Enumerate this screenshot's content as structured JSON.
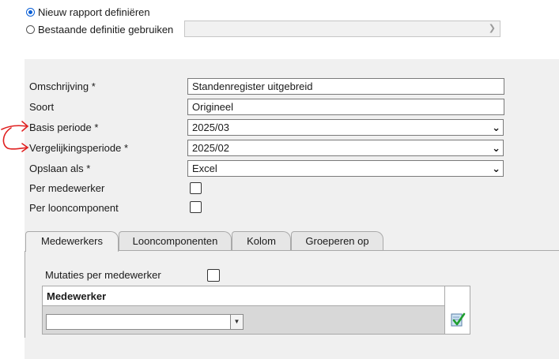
{
  "report_choice": {
    "new_label": "Nieuw rapport definiëren",
    "existing_label": "Bestaande definitie gebruiken",
    "existing_value": ""
  },
  "form": {
    "omschrijving_label": "Omschrijving *",
    "omschrijving_value": "Standenregister uitgebreid",
    "soort_label": "Soort",
    "soort_value": "Origineel",
    "basis_label": "Basis periode *",
    "basis_value": "2025/03",
    "vergelijk_label": "Vergelijkingsperiode *",
    "vergelijk_value": "2025/02",
    "opslaan_label": "Opslaan als *",
    "opslaan_value": "Excel",
    "per_medewerker_label": "Per medewerker",
    "per_looncomponent_label": "Per looncomponent"
  },
  "tabs": [
    {
      "label": "Medewerkers"
    },
    {
      "label": "Looncomponenten"
    },
    {
      "label": "Kolom"
    },
    {
      "label": "Groeperen op"
    }
  ],
  "medewerkers_tab": {
    "mutaties_label": "Mutaties per medewerker",
    "grid_header": "Medewerker",
    "combo_value": ""
  },
  "icons": {
    "dropdown": "chevron-down-icon",
    "apply": "checkmark-apply-icon",
    "annotation": "red-hand-drawn-arrows"
  },
  "colors": {
    "panel_bg": "#f0f0f0",
    "radio_accent": "#0a5fd6",
    "annotation": "#e02020",
    "check_green": "#1f9e2e"
  }
}
